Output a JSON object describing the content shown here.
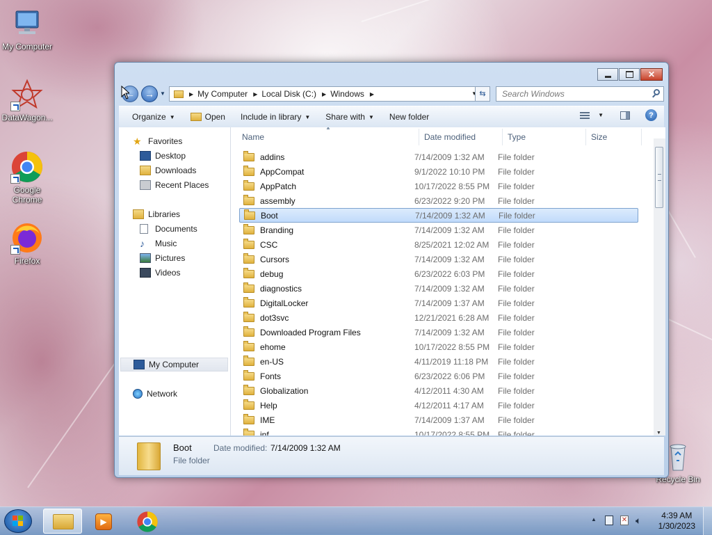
{
  "desktop": {
    "icons": [
      {
        "label": "My Computer",
        "icon": "my-computer-icon"
      },
      {
        "label": "DataWagon...",
        "icon": "datawagon-icon"
      },
      {
        "label": "Google Chrome",
        "icon": "chrome-icon"
      },
      {
        "label": "Firefox",
        "icon": "firefox-icon"
      },
      {
        "label": "Recycle Bin",
        "icon": "recycle-bin-icon"
      }
    ]
  },
  "window": {
    "address": {
      "crumbs": [
        "My Computer",
        "Local Disk (C:)",
        "Windows"
      ]
    },
    "search_placeholder": "Search Windows",
    "toolbar": {
      "organize": "Organize",
      "open": "Open",
      "include_in_library": "Include in library",
      "share_with": "Share with",
      "new_folder": "New folder"
    },
    "nav_pane": {
      "favorites": "Favorites",
      "desktop": "Desktop",
      "downloads": "Downloads",
      "recent_places": "Recent Places",
      "libraries": "Libraries",
      "documents": "Documents",
      "music": "Music",
      "pictures": "Pictures",
      "videos": "Videos",
      "my_computer": "My Computer",
      "network": "Network"
    },
    "columns": {
      "name": "Name",
      "date_modified": "Date modified",
      "type": "Type",
      "size": "Size"
    },
    "files": [
      {
        "name": "addins",
        "date": "7/14/2009 1:32 AM",
        "type": "File folder"
      },
      {
        "name": "AppCompat",
        "date": "9/1/2022 10:10 PM",
        "type": "File folder"
      },
      {
        "name": "AppPatch",
        "date": "10/17/2022 8:55 PM",
        "type": "File folder"
      },
      {
        "name": "assembly",
        "date": "6/23/2022 9:20 PM",
        "type": "File folder"
      },
      {
        "name": "Boot",
        "date": "7/14/2009 1:32 AM",
        "type": "File folder",
        "selected": true
      },
      {
        "name": "Branding",
        "date": "7/14/2009 1:32 AM",
        "type": "File folder"
      },
      {
        "name": "CSC",
        "date": "8/25/2021 12:02 AM",
        "type": "File folder"
      },
      {
        "name": "Cursors",
        "date": "7/14/2009 1:32 AM",
        "type": "File folder"
      },
      {
        "name": "debug",
        "date": "6/23/2022 6:03 PM",
        "type": "File folder"
      },
      {
        "name": "diagnostics",
        "date": "7/14/2009 1:32 AM",
        "type": "File folder"
      },
      {
        "name": "DigitalLocker",
        "date": "7/14/2009 1:37 AM",
        "type": "File folder"
      },
      {
        "name": "dot3svc",
        "date": "12/21/2021 6:28 AM",
        "type": "File folder"
      },
      {
        "name": "Downloaded Program Files",
        "date": "7/14/2009 1:32 AM",
        "type": "File folder"
      },
      {
        "name": "ehome",
        "date": "10/17/2022 8:55 PM",
        "type": "File folder"
      },
      {
        "name": "en-US",
        "date": "4/11/2019 11:18 PM",
        "type": "File folder"
      },
      {
        "name": "Fonts",
        "date": "6/23/2022 6:06 PM",
        "type": "File folder"
      },
      {
        "name": "Globalization",
        "date": "4/12/2011 4:30 AM",
        "type": "File folder"
      },
      {
        "name": "Help",
        "date": "4/12/2011 4:17 AM",
        "type": "File folder"
      },
      {
        "name": "IME",
        "date": "7/14/2009 1:37 AM",
        "type": "File folder"
      },
      {
        "name": "inf",
        "date": "10/17/2022 8:55 PM",
        "type": "File folder"
      }
    ],
    "details": {
      "name": "Boot",
      "date_label": "Date modified:",
      "date_value": "7/14/2009 1:32 AM",
      "type": "File folder"
    }
  },
  "taskbar": {
    "time": "4:39 AM",
    "date": "1/30/2023"
  }
}
